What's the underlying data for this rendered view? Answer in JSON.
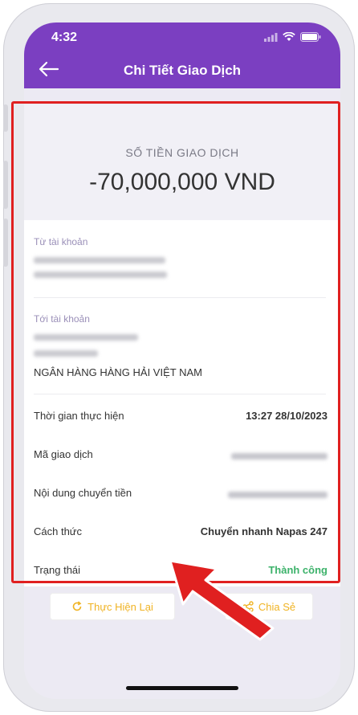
{
  "status_bar": {
    "time": "4:32"
  },
  "header": {
    "title": "Chi Tiết Giao Dịch"
  },
  "amount": {
    "label": "SỐ TIỀN GIAO DỊCH",
    "value": "-70,000,000 VND"
  },
  "from_account": {
    "label": "Từ tài khoản"
  },
  "to_account": {
    "label": "Tới tài khoản",
    "bank_name": "NGÂN HÀNG HÀNG HẢI VIỆT NAM"
  },
  "details": [
    {
      "label": "Thời gian thực hiện",
      "value": "13:27 28/10/2023"
    },
    {
      "label": "Mã giao dịch",
      "value": ""
    },
    {
      "label": "Nội dung chuyển tiền",
      "value": ""
    },
    {
      "label": "Cách thức",
      "value": "Chuyển nhanh Napas 247"
    },
    {
      "label": "Trạng thái",
      "value": "Thành công"
    }
  ],
  "actions": {
    "retry_label": "Thực Hiện Lại",
    "share_label": "Chia Sẻ"
  },
  "colors": {
    "header": "#7b3fc1",
    "success": "#3cb26a",
    "highlight": "#e02020",
    "action_text": "#f0b323"
  },
  "icons": [
    "back-arrow-icon",
    "signal-icon",
    "wifi-icon",
    "battery-icon",
    "retry-icon",
    "share-icon",
    "red-arrow-icon"
  ]
}
